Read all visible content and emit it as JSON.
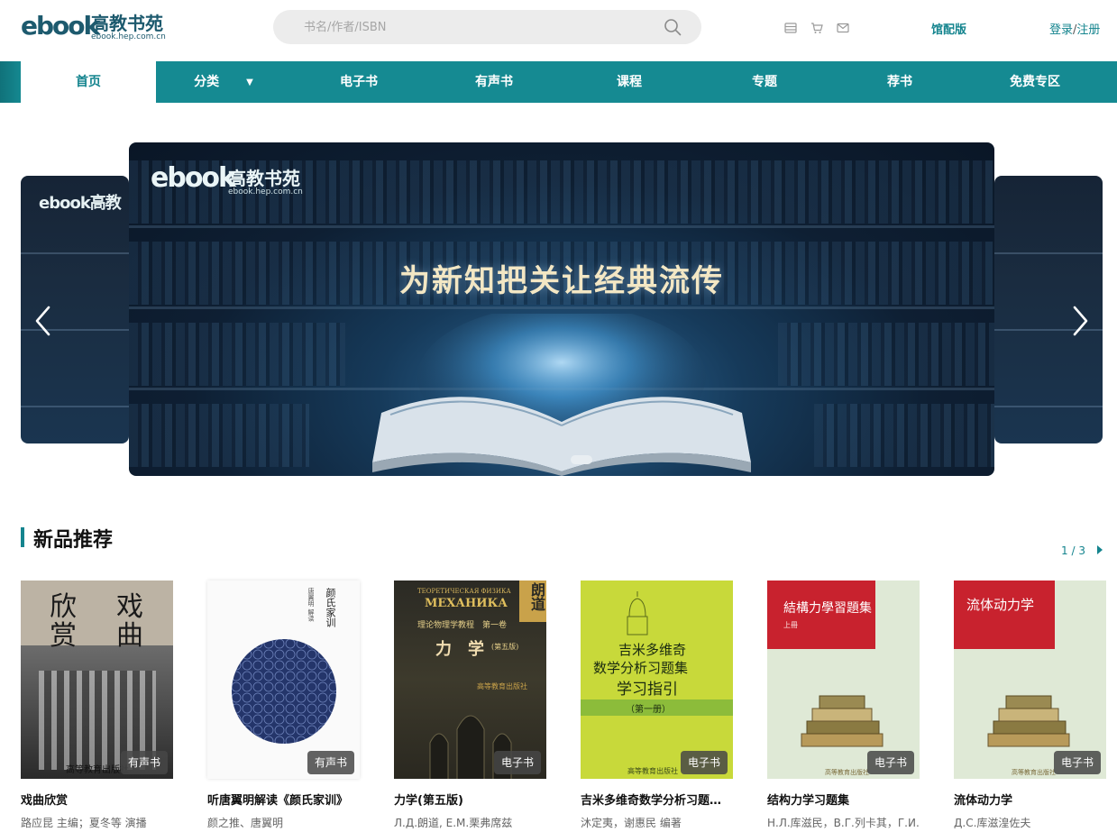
{
  "header": {
    "logo_mark": "ebook",
    "logo_cn": "高教书苑",
    "logo_url": "ebook.hep.com.cn",
    "search_placeholder": "书名/作者/ISBN",
    "library_label": "馆配版",
    "login_label": "登录",
    "login_sep": "/",
    "register_label": "注册"
  },
  "nav": {
    "items": [
      {
        "label": "首页"
      },
      {
        "label": "分类"
      },
      {
        "label": "电子书"
      },
      {
        "label": "有声书"
      },
      {
        "label": "课程"
      },
      {
        "label": "专题"
      },
      {
        "label": "荐书"
      },
      {
        "label": "免费专区"
      }
    ]
  },
  "carousel": {
    "slogan": "为新知把关让经典流传",
    "logo_mark": "ebook",
    "logo_cn": "高教书苑",
    "logo_url": "ebook.hep.com.cn",
    "side_logo": "ebook高教"
  },
  "section": {
    "title": "新品推荐",
    "page_current": "1",
    "page_sep": " / ",
    "page_total": "3"
  },
  "books": [
    {
      "title": "戏曲欣赏",
      "author": "路应昆 主编；夏冬等 演播",
      "badge": "有声书",
      "cover_text": [
        "戏",
        "曲",
        "欣",
        "赏"
      ],
      "cover_pub": "高等教育出版社"
    },
    {
      "title": "听唐翼明解读《颜氏家训》",
      "author": "颜之推、唐翼明",
      "badge": "有声书",
      "cover_text": [
        "颜氏家训",
        "唐翼明 解读"
      ]
    },
    {
      "title": "力学(第五版)",
      "author": "Л.Д.朗道, Е.М.栗弗席兹",
      "badge": "电子书",
      "cover_text": [
        "ТЕОРЕТИЧЕСКАЯ ФИЗИКА",
        "МЕХАНИКА",
        "理论物理学教程　第一卷",
        "力　学",
        "(第五版)",
        "朗道",
        "高等教育出版社"
      ]
    },
    {
      "title": "吉米多维奇数学分析习题集学习指引（第一册）",
      "author": "沐定夷，谢惠民 编著",
      "badge": "电子书",
      "cover_text": [
        "吉米多维奇",
        "数学分析习题集",
        "学习指引",
        "（第一册）",
        "高等教育出版社"
      ]
    },
    {
      "title": "结构力学习题集",
      "author": "Н.Л.库滋民，В.Г.列卡其，Г.И.",
      "badge": "电子书",
      "cover_text": [
        "結構力學習題集",
        "上冊",
        "高等教育出版社"
      ]
    },
    {
      "title": "流体动力学",
      "author": "Д.С.库滋湟佐夫",
      "badge": "电子书",
      "cover_text": [
        "流体动力学",
        "高等教育出版社"
      ]
    }
  ],
  "colors": {
    "accent": "#158a92",
    "accent_text": "#14848e",
    "badge_bg": "#464646"
  }
}
